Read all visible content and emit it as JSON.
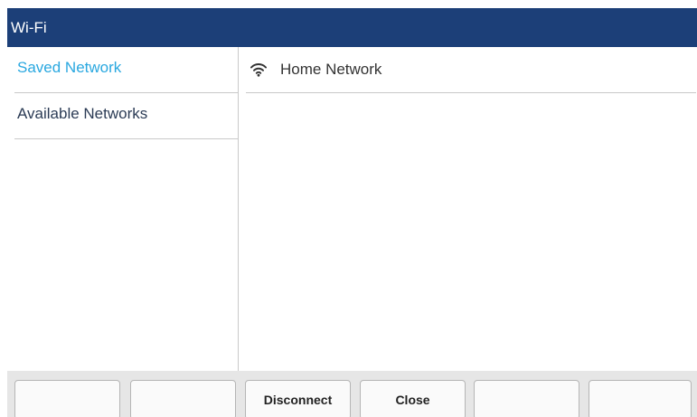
{
  "header": {
    "title": "Wi-Fi"
  },
  "sidebar": {
    "items": [
      {
        "label": "Saved Network",
        "active": true
      },
      {
        "label": "Available Networks",
        "active": false
      }
    ]
  },
  "main": {
    "networks": [
      {
        "name": "Home Network",
        "icon": "wifi-icon"
      }
    ]
  },
  "softkeys": [
    "",
    "",
    "Disconnect",
    "Close",
    "",
    ""
  ],
  "colors": {
    "title_bar": "#1c3f78",
    "active_item": "#2aa8e0",
    "softkey_bar": "#e6e6e6"
  }
}
